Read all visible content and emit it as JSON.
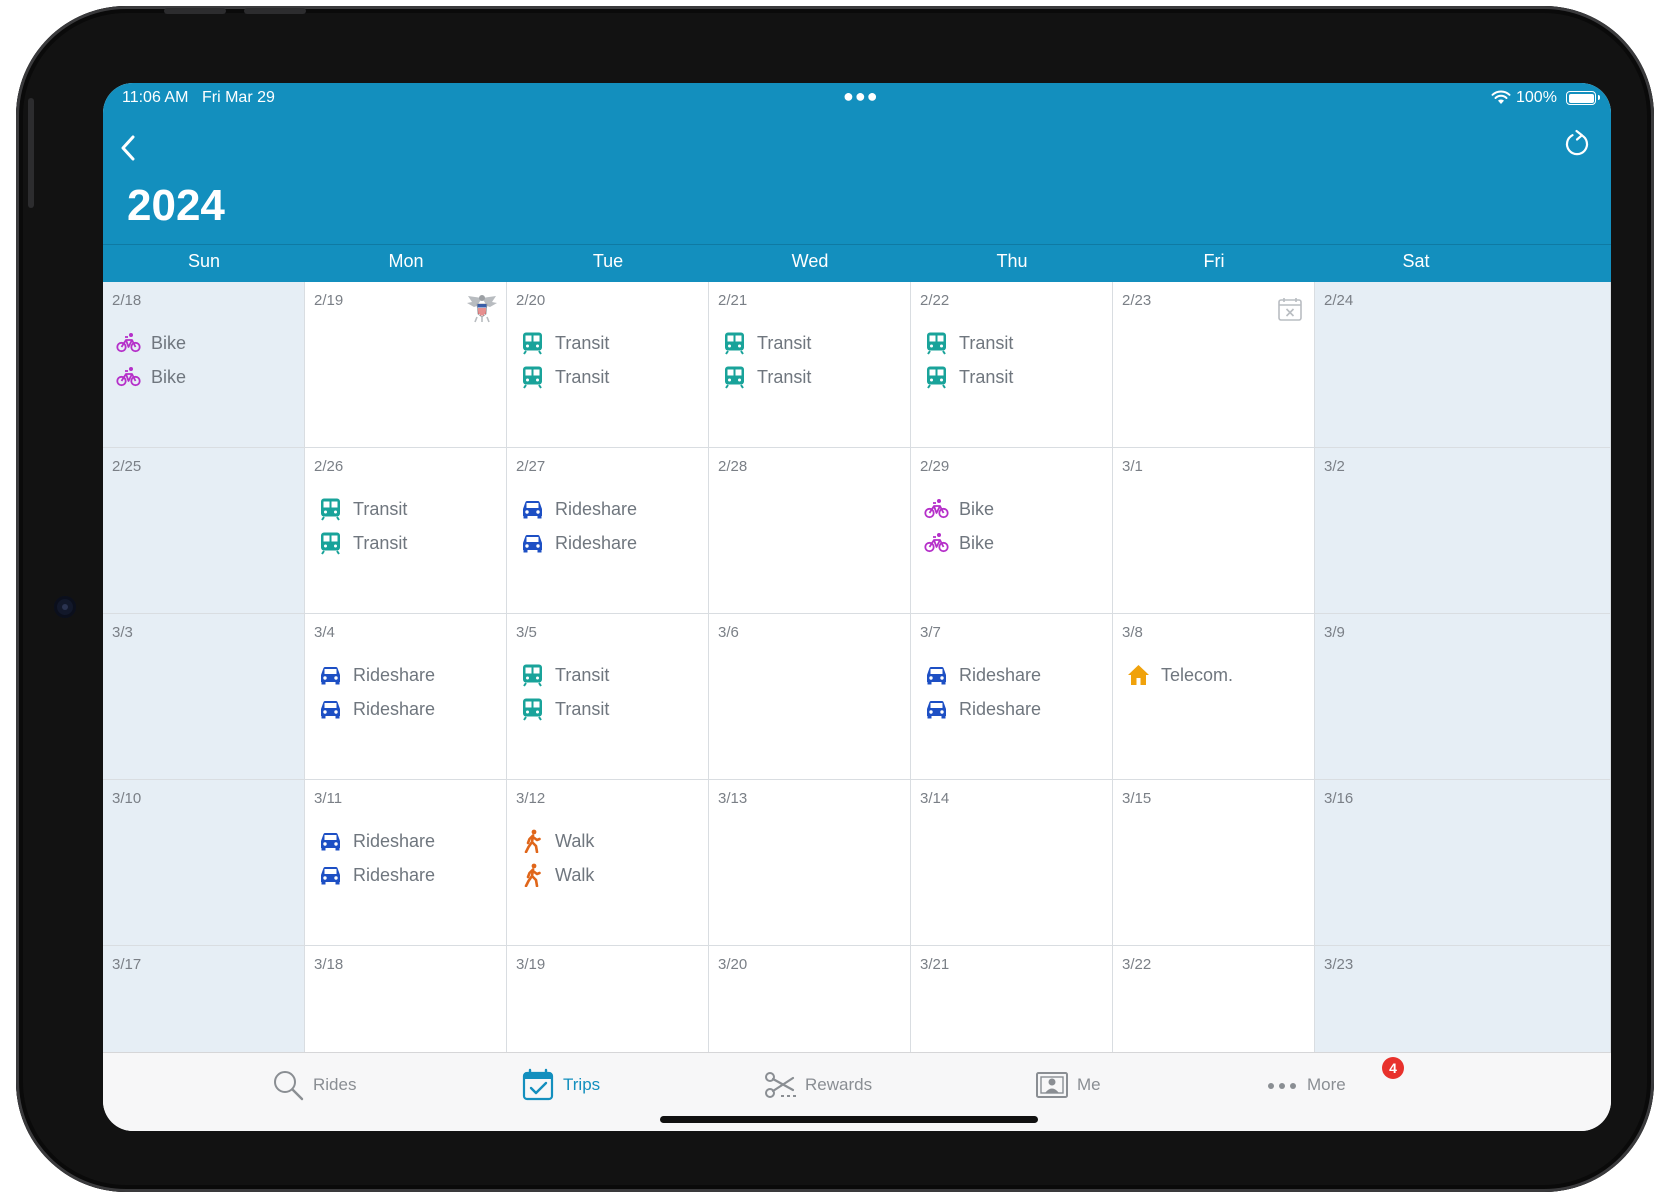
{
  "status_bar": {
    "time": "11:06 AM",
    "date": "Fri Mar 29",
    "battery": "100%"
  },
  "header": {
    "title": "2024"
  },
  "colors": {
    "header": "#138fbe",
    "bike": "#b52fc9",
    "transit": "#19a39a",
    "rideshare": "#1d4fc4",
    "walk": "#e0661a",
    "telecom": "#f0a20c",
    "weekend": "#e6eef5",
    "badge": "#e8312c"
  },
  "weekdays": [
    "Sun",
    "Mon",
    "Tue",
    "Wed",
    "Thu",
    "Fri",
    "Sat"
  ],
  "calendar": [
    {
      "date": "2/18",
      "trips": [
        {
          "type": "bike",
          "label": "Bike"
        },
        {
          "type": "bike",
          "label": "Bike"
        }
      ]
    },
    {
      "date": "2/19",
      "marker": "holiday",
      "trips": []
    },
    {
      "date": "2/20",
      "trips": [
        {
          "type": "transit",
          "label": "Transit"
        },
        {
          "type": "transit",
          "label": "Transit"
        }
      ]
    },
    {
      "date": "2/21",
      "trips": [
        {
          "type": "transit",
          "label": "Transit"
        },
        {
          "type": "transit",
          "label": "Transit"
        }
      ]
    },
    {
      "date": "2/22",
      "trips": [
        {
          "type": "transit",
          "label": "Transit"
        },
        {
          "type": "transit",
          "label": "Transit"
        }
      ]
    },
    {
      "date": "2/23",
      "marker": "cancelled",
      "trips": []
    },
    {
      "date": "2/24",
      "trips": []
    },
    {
      "date": "2/25",
      "trips": []
    },
    {
      "date": "2/26",
      "trips": [
        {
          "type": "transit",
          "label": "Transit"
        },
        {
          "type": "transit",
          "label": "Transit"
        }
      ]
    },
    {
      "date": "2/27",
      "trips": [
        {
          "type": "rideshare",
          "label": "Rideshare"
        },
        {
          "type": "rideshare",
          "label": "Rideshare"
        }
      ]
    },
    {
      "date": "2/28",
      "trips": []
    },
    {
      "date": "2/29",
      "trips": [
        {
          "type": "bike",
          "label": "Bike"
        },
        {
          "type": "bike",
          "label": "Bike"
        }
      ]
    },
    {
      "date": "3/1",
      "trips": []
    },
    {
      "date": "3/2",
      "trips": []
    },
    {
      "date": "3/3",
      "trips": []
    },
    {
      "date": "3/4",
      "trips": [
        {
          "type": "rideshare",
          "label": "Rideshare"
        },
        {
          "type": "rideshare",
          "label": "Rideshare"
        }
      ]
    },
    {
      "date": "3/5",
      "trips": [
        {
          "type": "transit",
          "label": "Transit"
        },
        {
          "type": "transit",
          "label": "Transit"
        }
      ]
    },
    {
      "date": "3/6",
      "trips": []
    },
    {
      "date": "3/7",
      "trips": [
        {
          "type": "rideshare",
          "label": "Rideshare"
        },
        {
          "type": "rideshare",
          "label": "Rideshare"
        }
      ]
    },
    {
      "date": "3/8",
      "trips": [
        {
          "type": "telecom",
          "label": "Telecom."
        }
      ]
    },
    {
      "date": "3/9",
      "trips": []
    },
    {
      "date": "3/10",
      "trips": []
    },
    {
      "date": "3/11",
      "trips": [
        {
          "type": "rideshare",
          "label": "Rideshare"
        },
        {
          "type": "rideshare",
          "label": "Rideshare"
        }
      ]
    },
    {
      "date": "3/12",
      "trips": [
        {
          "type": "walk",
          "label": "Walk"
        },
        {
          "type": "walk",
          "label": "Walk"
        }
      ]
    },
    {
      "date": "3/13",
      "trips": []
    },
    {
      "date": "3/14",
      "trips": []
    },
    {
      "date": "3/15",
      "trips": []
    },
    {
      "date": "3/16",
      "trips": []
    },
    {
      "date": "3/17",
      "trips": []
    },
    {
      "date": "3/18",
      "trips": []
    },
    {
      "date": "3/19",
      "trips": []
    },
    {
      "date": "3/20",
      "trips": []
    },
    {
      "date": "3/21",
      "trips": []
    },
    {
      "date": "3/22",
      "trips": []
    },
    {
      "date": "3/23",
      "trips": []
    }
  ],
  "tabs": [
    {
      "label": "Rides",
      "icon": "search-icon",
      "active": false
    },
    {
      "label": "Trips",
      "icon": "calendar-check-icon",
      "active": true
    },
    {
      "label": "Rewards",
      "icon": "scissors-coupon-icon",
      "active": false
    },
    {
      "label": "Me",
      "icon": "profile-card-icon",
      "active": false
    },
    {
      "label": "More",
      "icon": "more-dots-icon",
      "active": false,
      "badge": "4"
    }
  ]
}
